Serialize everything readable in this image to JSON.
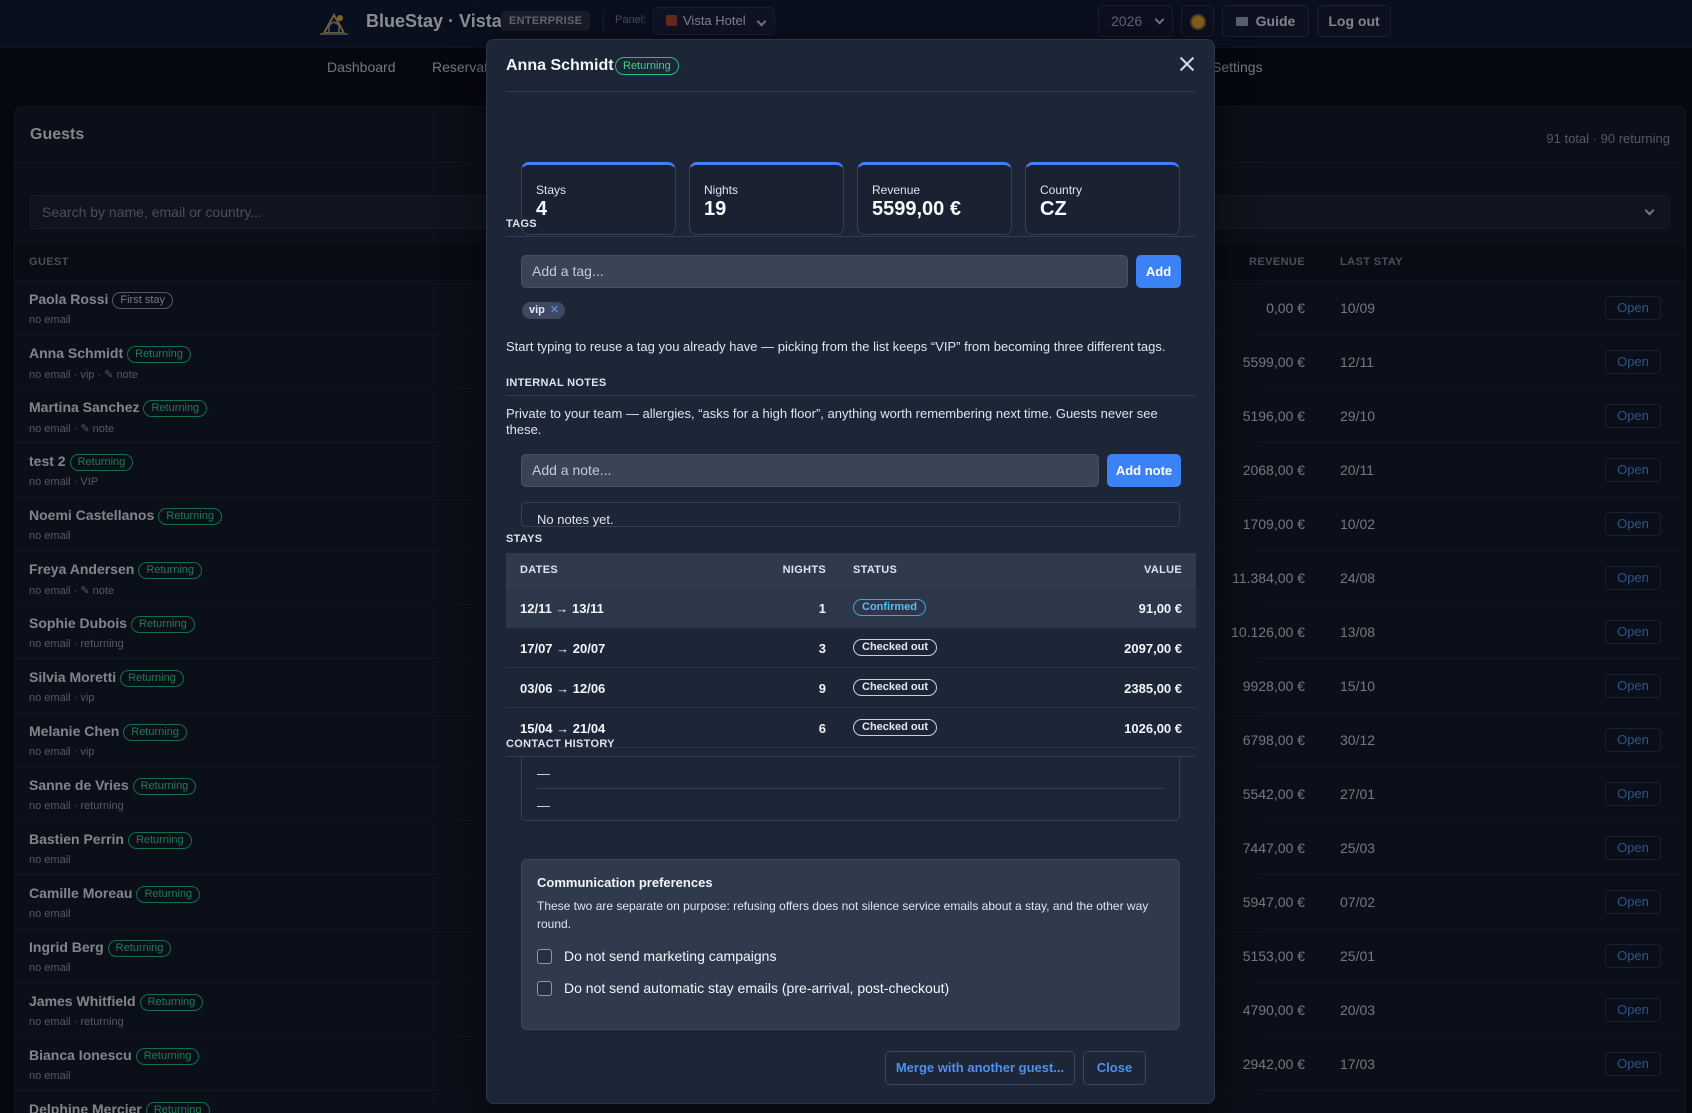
{
  "header": {
    "brand": "BlueStay · Vista",
    "edition": "ENTERPRISE",
    "panel_label": "Panel:",
    "panel_value": "Vista Hotel",
    "year": "2026",
    "guide": "Guide",
    "logout": "Log out"
  },
  "nav": {
    "items": [
      "Dashboard",
      "Reservat",
      "Settings"
    ]
  },
  "guests": {
    "title": "Guests",
    "count": "91 total · 90 returning",
    "search_placeholder": "Search by name, email or country...",
    "columns": {
      "guest": "GUEST",
      "revenue": "REVENUE",
      "last_stay": "LAST STAY"
    },
    "open_label": "Open",
    "rows": [
      {
        "name": "Paola Rossi",
        "badge": "First stay",
        "sub": "no email",
        "revenue": "0,00 €",
        "last": "10/09"
      },
      {
        "name": "Anna Schmidt",
        "badge": "Returning",
        "sub": "no email · vip · ✎ note",
        "revenue": "5599,00 €",
        "last": "12/11"
      },
      {
        "name": "Martina Sanchez",
        "badge": "Returning",
        "sub": "no email · ✎ note",
        "revenue": "5196,00 €",
        "last": "29/10"
      },
      {
        "name": "test 2",
        "badge": "Returning",
        "sub": "no email · VIP",
        "revenue": "2068,00 €",
        "last": "20/11"
      },
      {
        "name": "Noemi Castellanos",
        "badge": "Returning",
        "sub": "no email",
        "revenue": "1709,00 €",
        "last": "10/02"
      },
      {
        "name": "Freya Andersen",
        "badge": "Returning",
        "sub": "no email · ✎ note",
        "revenue": "11.384,00 €",
        "last": "24/08"
      },
      {
        "name": "Sophie Dubois",
        "badge": "Returning",
        "sub": "no email · returning",
        "revenue": "10.126,00 €",
        "last": "13/08"
      },
      {
        "name": "Silvia Moretti",
        "badge": "Returning",
        "sub": "no email · vip",
        "revenue": "9928,00 €",
        "last": "15/10"
      },
      {
        "name": "Melanie Chen",
        "badge": "Returning",
        "sub": "no email · vip",
        "revenue": "6798,00 €",
        "last": "30/12"
      },
      {
        "name": "Sanne de Vries",
        "badge": "Returning",
        "sub": "no email · returning",
        "revenue": "5542,00 €",
        "last": "27/01"
      },
      {
        "name": "Bastien Perrin",
        "badge": "Returning",
        "sub": "no email",
        "revenue": "7447,00 €",
        "last": "25/03"
      },
      {
        "name": "Camille Moreau",
        "badge": "Returning",
        "sub": "no email",
        "revenue": "5947,00 €",
        "last": "07/02"
      },
      {
        "name": "Ingrid Berg",
        "badge": "Returning",
        "sub": "no email",
        "revenue": "5153,00 €",
        "last": "25/01"
      },
      {
        "name": "James Whitfield",
        "badge": "Returning",
        "sub": "no email · returning",
        "revenue": "4790,00 €",
        "last": "20/03"
      },
      {
        "name": "Bianca Ionescu",
        "badge": "Returning",
        "sub": "no email",
        "revenue": "2942,00 €",
        "last": "17/03"
      },
      {
        "name": "Delphine Mercier",
        "badge": "Returning",
        "sub": "",
        "revenue": "",
        "last": ""
      }
    ]
  },
  "modal": {
    "name": "Anna Schmidt",
    "badge": "Returning",
    "stats": [
      {
        "label": "Stays",
        "value": "4"
      },
      {
        "label": "Nights",
        "value": "19"
      },
      {
        "label": "Revenue",
        "value": "5599,00 €"
      },
      {
        "label": "Country",
        "value": "CZ"
      }
    ],
    "tags_heading": "TAGS",
    "tag_placeholder": "Add a tag...",
    "tag_add": "Add",
    "tags": [
      "vip"
    ],
    "tags_hint": "Start typing to reuse a tag you already have — picking from the list keeps “VIP” from becoming three different tags.",
    "notes_heading": "INTERNAL NOTES",
    "notes_hint": "Private to your team — allergies, “asks for a high floor”, anything worth remembering next time. Guests never see these.",
    "note_placeholder": "Add a note...",
    "note_add": "Add note",
    "notes_empty": "No notes yet.",
    "stays_heading": "STAYS",
    "stays_columns": {
      "dates": "DATES",
      "nights": "NIGHTS",
      "status": "STATUS",
      "value": "VALUE"
    },
    "stays": [
      {
        "dates": "12/11 → 13/11",
        "nights": "1",
        "status": "Confirmed",
        "value": "91,00 €"
      },
      {
        "dates": "17/07 → 20/07",
        "nights": "3",
        "status": "Checked out",
        "value": "2097,00 €"
      },
      {
        "dates": "03/06 → 12/06",
        "nights": "9",
        "status": "Checked out",
        "value": "2385,00 €"
      },
      {
        "dates": "15/04 → 21/04",
        "nights": "6",
        "status": "Checked out",
        "value": "1026,00 €"
      }
    ],
    "contact_heading": "CONTACT HISTORY",
    "contact_items": [
      "—",
      "—"
    ],
    "comm_title": "Communication preferences",
    "comm_text": "These two are separate on purpose: refusing offers does not silence service emails about a stay, and the other way round.",
    "comm_marketing": "Do not send marketing campaigns",
    "comm_auto": "Do not send automatic stay emails (pre-arrival, post-checkout)",
    "merge": "Merge with another guest...",
    "close": "Close"
  }
}
